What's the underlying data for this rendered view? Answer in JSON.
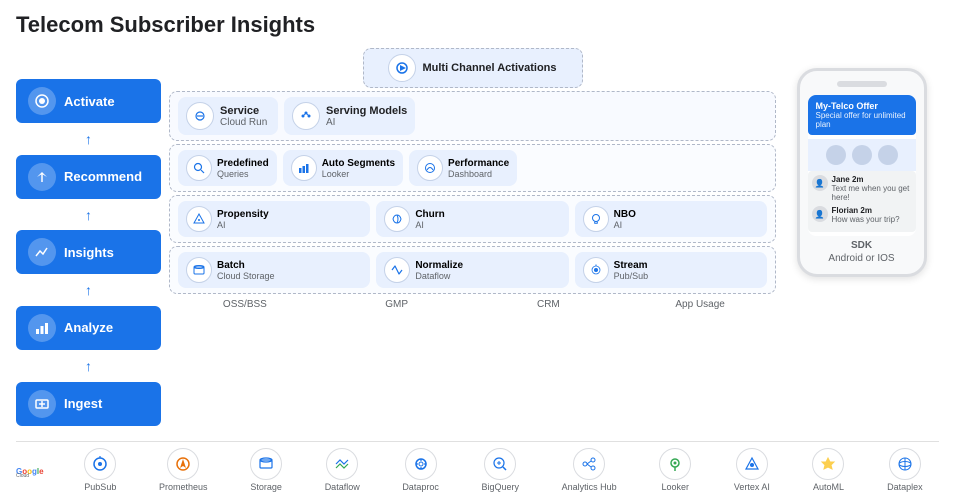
{
  "title": "Telecom Subscriber Insights",
  "sidebar": {
    "items": [
      {
        "id": "activate",
        "label": "Activate",
        "icon": "🔔"
      },
      {
        "id": "recommend",
        "label": "Recommend",
        "icon": "↗"
      },
      {
        "id": "insights",
        "label": "Insights",
        "icon": "📈"
      },
      {
        "id": "analyze",
        "label": "Analyze",
        "icon": "📊"
      },
      {
        "id": "ingest",
        "label": "Ingest",
        "icon": "📥"
      }
    ]
  },
  "diagram": {
    "row1": {
      "label": "Multi Channel Activations",
      "sub": "",
      "icon": "▶"
    },
    "row2": [
      {
        "title": "Service",
        "sub": "Cloud Run",
        "icon": "⚙"
      },
      {
        "title": "Serving Models",
        "sub": "AI",
        "icon": "🧠"
      }
    ],
    "row3": [
      {
        "title": "Predefined",
        "sub": "Queries",
        "icon": "🔍"
      },
      {
        "title": "Auto Segments",
        "sub": "Looker",
        "icon": "📊"
      },
      {
        "title": "Performance",
        "sub": "Dashboard",
        "icon": "⚡"
      }
    ],
    "row4": [
      {
        "title": "Propensity",
        "sub": "AI",
        "icon": "🔮"
      },
      {
        "title": "Churn",
        "sub": "AI",
        "icon": "♻"
      },
      {
        "title": "NBO",
        "sub": "AI",
        "icon": "💡"
      }
    ],
    "row5": [
      {
        "title": "Batch",
        "sub": "Cloud Storage",
        "icon": "📦"
      },
      {
        "title": "Normalize",
        "sub": "Dataflow",
        "icon": "🔄"
      },
      {
        "title": "Stream",
        "sub": "Pub/Sub",
        "icon": "📡"
      }
    ],
    "source_labels": [
      "OSS/BSS",
      "GMP",
      "CRM",
      "App Usage"
    ]
  },
  "phone": {
    "offer_title": "My-Telco Offer",
    "offer_sub": "Special offer for unlimited plan",
    "chats": [
      {
        "name": "Jane 2m",
        "msg": "Text me when you get here!"
      },
      {
        "name": "Florian 2m",
        "msg": "How was your trip?"
      }
    ],
    "sdk_label": "SDK",
    "os_label": "Android or IOS"
  },
  "bottom_bar": {
    "logo_text1": "Google",
    "logo_text2": "Cloud",
    "icons": [
      {
        "label": "PubSub",
        "icon": "📨"
      },
      {
        "label": "Prometheus",
        "icon": "🔥"
      },
      {
        "label": "Storage",
        "icon": "🗄"
      },
      {
        "label": "Dataflow",
        "icon": "🔀"
      },
      {
        "label": "Dataproc",
        "icon": "⚙"
      },
      {
        "label": "BigQuery",
        "icon": "🔎"
      },
      {
        "label": "Analytics Hub",
        "icon": "🔗"
      },
      {
        "label": "Looker",
        "icon": "👁"
      },
      {
        "label": "Vertex AI",
        "icon": "🤖"
      },
      {
        "label": "AutoML",
        "icon": "✨"
      },
      {
        "label": "Dataplex",
        "icon": "🌐"
      }
    ]
  }
}
